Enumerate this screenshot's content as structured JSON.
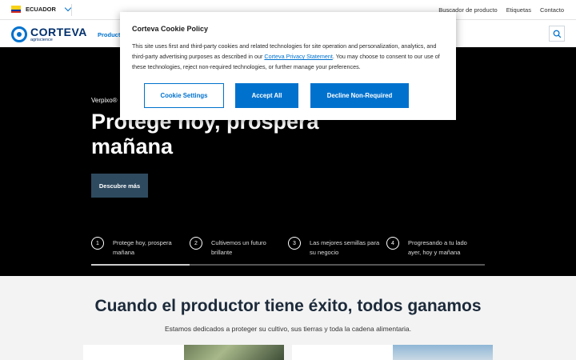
{
  "topbar": {
    "country": "ECUADOR",
    "links": [
      "Buscador de producto",
      "Etiquetas",
      "Contacto"
    ]
  },
  "header": {
    "logo_word": "CORTEVA",
    "logo_sub": "agriscience",
    "nav_item": "Producto"
  },
  "hero": {
    "eyebrow": "Verpixo®",
    "title": "Protege hoy, prospera mañana",
    "cta": "Descubre más",
    "slides": [
      {
        "num": "1",
        "label": "Protege hoy, prospera mañana"
      },
      {
        "num": "2",
        "label": "Cultivemos un futuro brillante"
      },
      {
        "num": "3",
        "label": "Las mejores semillas para su negocio"
      },
      {
        "num": "4",
        "label": "Progresando a tu lado ayer, hoy y mañana"
      }
    ]
  },
  "section": {
    "title": "Cuando el productor tiene éxito, todos ganamos",
    "subtitle": "Estamos dedicados a proteger su cultivo, sus tierras y toda la cadena alimentaria."
  },
  "cookie": {
    "title": "Corteva Cookie Policy",
    "body_before": "This site uses first and third-party cookies and related technologies for site operation and personalization, analytics, and third-party advertising purposes as described in our ",
    "link": "Corteva Privacy Statement",
    "body_after": ". You may choose to consent to our use of these technologies, reject non-required technologies, or further manage your preferences.",
    "settings_label": "Cookie Settings",
    "accept_label": "Accept All",
    "decline_label": "Decline Non-Required"
  },
  "colors": {
    "accent": "#0072ce",
    "brand_navy": "#002f6c",
    "hero_bg": "#000000",
    "cta_bg": "#2e4a5f"
  },
  "icons": [
    "ecuador-flag-icon",
    "chevron-down-icon",
    "corteva-logo-icon",
    "search-icon"
  ]
}
